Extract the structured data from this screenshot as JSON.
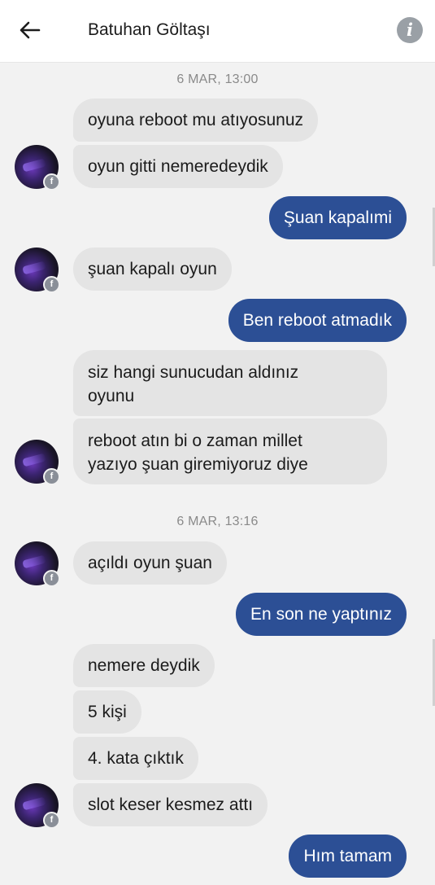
{
  "header": {
    "title": "Batuhan Göltaşı",
    "back_icon": "arrow-left-icon",
    "info_icon": "info-icon",
    "info_glyph": "i"
  },
  "timestamps": [
    "6 MAR, 13:00",
    "6 MAR, 13:16"
  ],
  "messages": [
    {
      "side": "in",
      "text": "oyuna reboot mu atıyosunuz"
    },
    {
      "side": "in",
      "text": "oyun gitti nemeredeydik"
    },
    {
      "side": "out",
      "text": "Şuan kapalımi"
    },
    {
      "side": "in",
      "text": "şuan kapalı oyun"
    },
    {
      "side": "out",
      "text": "Ben reboot atmadık"
    },
    {
      "side": "in",
      "text": "siz hangi sunucudan aldınız oyunu",
      "line1": "siz hangi sunucudan aldınız",
      "line2": "oyunu"
    },
    {
      "side": "in",
      "text": "reboot atın bi o zaman millet yazıyo şuan giremiyoruz diye",
      "line1": "reboot atın bi o zaman millet",
      "line2": "yazıyo şuan giremiyoruz diye"
    },
    {
      "side": "in",
      "text": "açıldı oyun şuan"
    },
    {
      "side": "out",
      "text": "En son ne yaptınız"
    },
    {
      "side": "in",
      "text": "nemere deydik"
    },
    {
      "side": "in",
      "text": "5 kişi"
    },
    {
      "side": "in",
      "text": "4. kata çıktık"
    },
    {
      "side": "in",
      "text": "slot keser kesmez attı"
    },
    {
      "side": "out",
      "text": "Hım tamam"
    }
  ],
  "avatar": {
    "badge": "f",
    "badge_icon": "facebook-icon"
  },
  "colors": {
    "outgoing": "#2c4f95",
    "incoming": "#e4e4e4",
    "background": "#f2f2f2"
  }
}
